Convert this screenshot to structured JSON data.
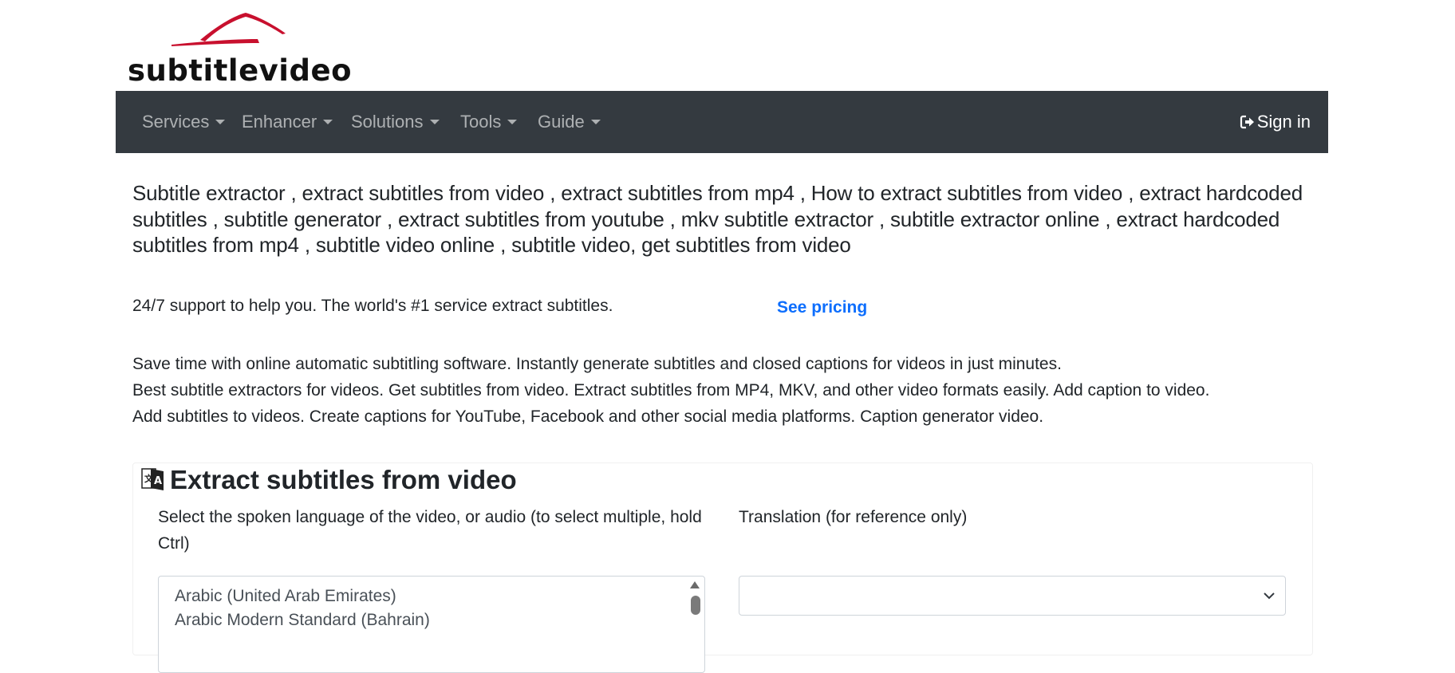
{
  "brand": {
    "logo_text": "subtitlevideo",
    "accent_color": "#c8102e"
  },
  "navbar": {
    "items": [
      {
        "label": "Services"
      },
      {
        "label": "Enhancer"
      },
      {
        "label": "Solutions"
      },
      {
        "label": "Tools"
      },
      {
        "label": "Guide"
      }
    ],
    "signin_label": "Sign in",
    "signin_icon": "sign-in-icon",
    "background_color": "#343a40"
  },
  "main": {
    "keywords_text": "Subtitle extractor , extract subtitles from video , extract subtitles from mp4 , How to extract subtitles from video , extract hardcoded subtitles , subtitle generator , extract subtitles from youtube , mkv subtitle extractor , subtitle extractor online , extract hardcoded subtitles from mp4 , subtitle video online , subtitle video, get subtitles from video",
    "support_text": "24/7 support to help you. The world's #1 service extract subtitles.",
    "see_pricing_label": "See pricing",
    "link_color": "#0d6efd",
    "description_lines": [
      "Save time with online automatic subtitling software. Instantly generate subtitles and closed captions for videos in just minutes.",
      "Best subtitle extractors for videos. Get subtitles from video. Extract subtitles from MP4, MKV, and other video formats easily. Add caption to video.",
      "Add subtitles to videos. Create captions for YouTube, Facebook and other social media platforms. Caption generator video."
    ]
  },
  "extract_card": {
    "title": "Extract subtitles from video",
    "title_icon": "translate-icon",
    "language_label": "Select the spoken language of the video, or audio (to select multiple, hold Ctrl)",
    "language_options": [
      "Arabic (United Arab Emirates)",
      "Arabic Modern Standard (Bahrain)"
    ],
    "translation_label": "Translation (for reference only)",
    "translation_value": ""
  }
}
